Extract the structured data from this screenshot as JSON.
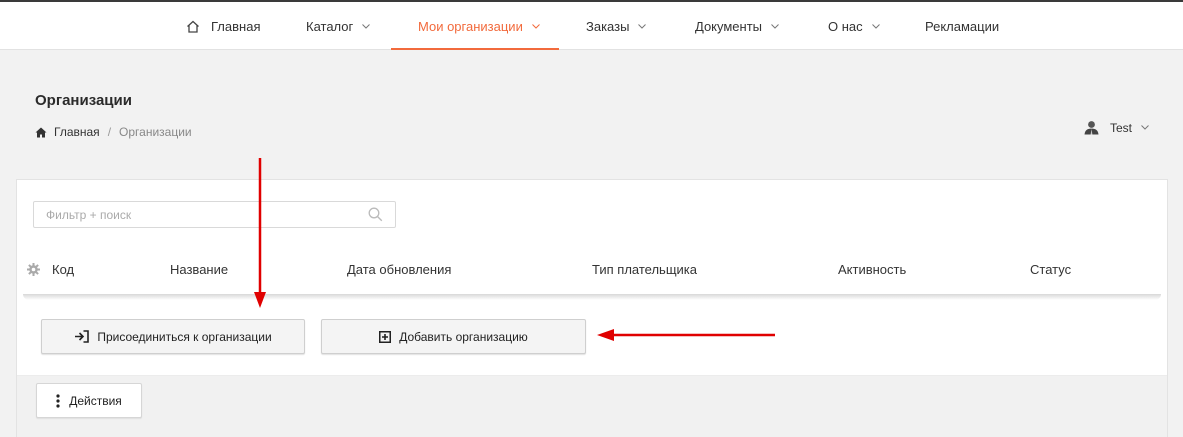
{
  "nav": {
    "items": [
      {
        "label": "Главная",
        "icon": "home-outline-icon"
      },
      {
        "label": "Каталог"
      },
      {
        "label": "Мои организации",
        "active": true
      },
      {
        "label": "Заказы"
      },
      {
        "label": "Документы"
      },
      {
        "label": "О нас"
      },
      {
        "label": "Рекламации"
      }
    ],
    "active_color": "#f26a3c"
  },
  "page": {
    "title": "Организации",
    "breadcrumb": {
      "home": "Главная",
      "separator": "/",
      "current": "Организации"
    }
  },
  "user": {
    "name": "Test",
    "icon": "user-avatar-icon"
  },
  "table": {
    "filter_placeholder": "Фильтр + поиск",
    "columns": [
      "Код",
      "Название",
      "Дата обновления",
      "Тип плательщика",
      "Активность",
      "Статус"
    ]
  },
  "buttons": {
    "join": "Присоединиться к организации",
    "add": "Добавить организацию",
    "actions": "Действия"
  },
  "annotation_color": "#e00000"
}
